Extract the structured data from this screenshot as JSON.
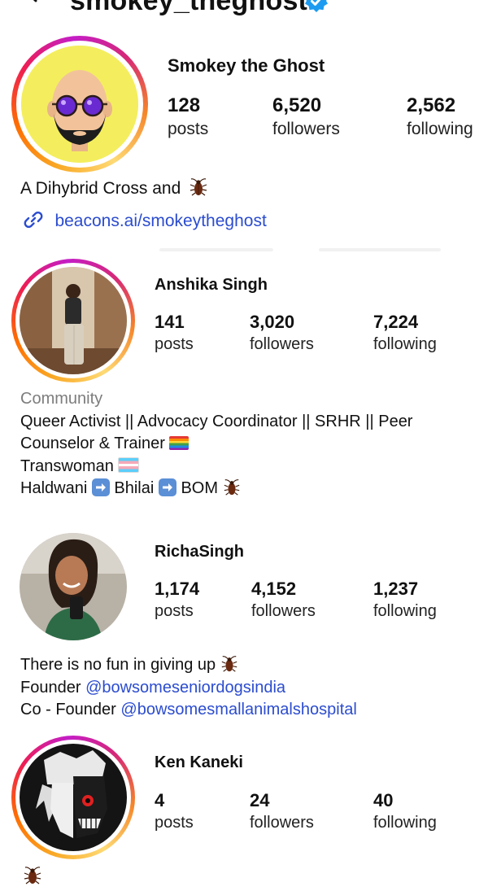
{
  "header": {
    "username": "smokey_theghost"
  },
  "profiles": [
    {
      "name": "Smokey the Ghost",
      "stats": [
        {
          "num": "128",
          "label": "posts"
        },
        {
          "num": "6,520",
          "label": "followers"
        },
        {
          "num": "2,562",
          "label": "following"
        }
      ],
      "bio": [
        "A Dihybrid Cross and"
      ],
      "link": "beacons.ai/smokeytheghost"
    },
    {
      "name": "Anshika Singh",
      "stats": [
        {
          "num": "141",
          "label": "posts"
        },
        {
          "num": "3,020",
          "label": "followers"
        },
        {
          "num": "7,224",
          "label": "following"
        }
      ],
      "category": "Community",
      "bio": [
        "Queer Activist || Advocacy Coordinator || SRHR || Peer",
        "Counselor & Trainer",
        "Transwoman",
        "Haldwani",
        "Bhilai",
        "BOM"
      ]
    },
    {
      "name": "RichaSingh",
      "stats": [
        {
          "num": "1,174",
          "label": "posts"
        },
        {
          "num": "4,152",
          "label": "followers"
        },
        {
          "num": "1,237",
          "label": "following"
        }
      ],
      "bio": [
        "There is no fun in giving up",
        "Founder ",
        "@bowsomeseniordogsindia",
        "Co - Founder ",
        "@bowsomesmallanimalshospital"
      ]
    },
    {
      "name": "Ken Kaneki",
      "stats": [
        {
          "num": "4",
          "label": "posts"
        },
        {
          "num": "24",
          "label": "followers"
        },
        {
          "num": "40",
          "label": "following"
        }
      ]
    }
  ],
  "colors": {
    "link": "#2b4ccf",
    "verified": "#1d9bf0",
    "story_ring": [
      "#f9a825",
      "#ee1d52",
      "#c41ec7"
    ]
  },
  "icons": [
    "back-arrow-icon",
    "verified-badge-icon",
    "link-icon",
    "cockroach-emoji-icon",
    "rainbow-flag-emoji-icon",
    "transgender-flag-emoji-icon",
    "right-arrow-emoji-icon"
  ]
}
